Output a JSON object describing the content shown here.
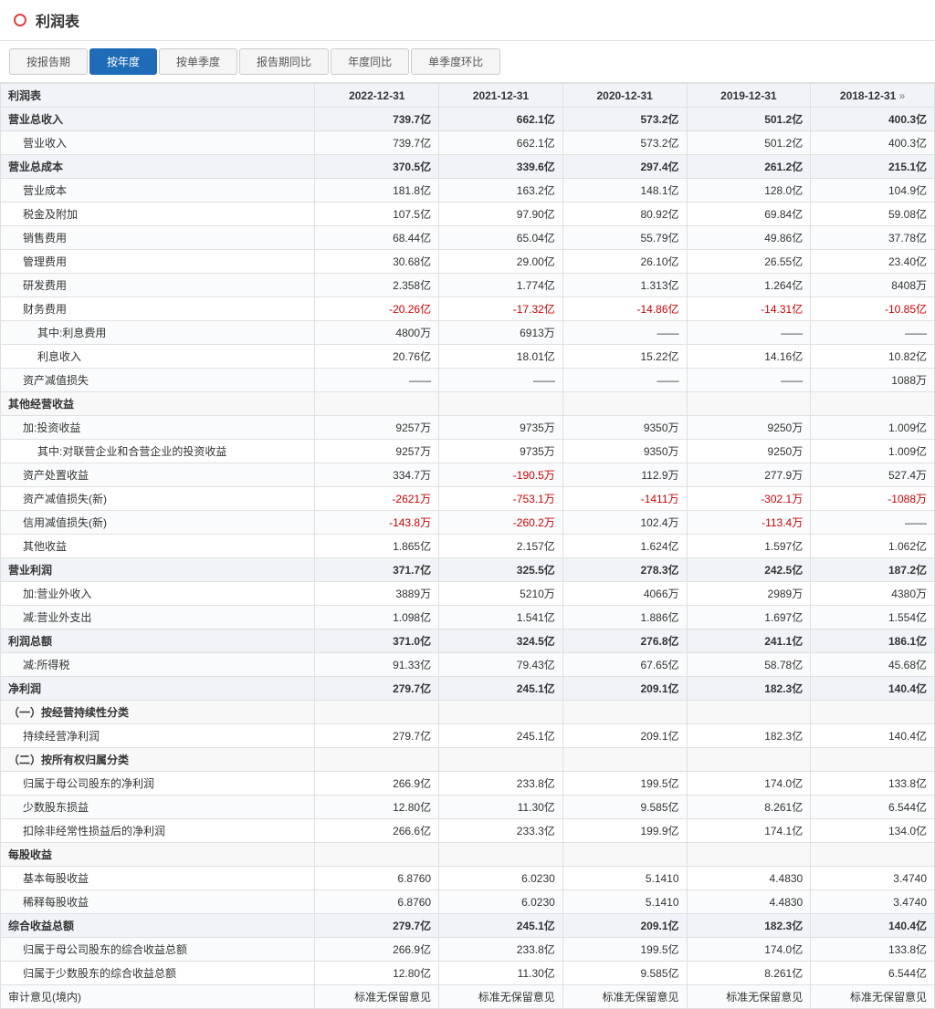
{
  "header": {
    "title": "利润表",
    "icon_label": "circle-icon"
  },
  "tabs": [
    {
      "id": "by-report",
      "label": "按报告期",
      "active": false
    },
    {
      "id": "by-year",
      "label": "按年度",
      "active": true
    },
    {
      "id": "by-quarter",
      "label": "按单季度",
      "active": false
    },
    {
      "id": "yoy-report",
      "label": "报告期同比",
      "active": false
    },
    {
      "id": "yoy-year",
      "label": "年度同比",
      "active": false
    },
    {
      "id": "qoq-quarter",
      "label": "单季度环比",
      "active": false
    }
  ],
  "columns": [
    "利润表",
    "2022-12-31",
    "2021-12-31",
    "2020-12-31",
    "2019-12-31",
    "2018-12-31"
  ],
  "rows": [
    {
      "label": "营业总收入",
      "values": [
        "739.7亿",
        "662.1亿",
        "573.2亿",
        "501.2亿",
        "400.3亿"
      ],
      "type": "bold"
    },
    {
      "label": "营业收入",
      "values": [
        "739.7亿",
        "662.1亿",
        "573.2亿",
        "501.2亿",
        "400.3亿"
      ],
      "type": "indent-1"
    },
    {
      "label": "营业总成本",
      "values": [
        "370.5亿",
        "339.6亿",
        "297.4亿",
        "261.2亿",
        "215.1亿"
      ],
      "type": "bold"
    },
    {
      "label": "营业成本",
      "values": [
        "181.8亿",
        "163.2亿",
        "148.1亿",
        "128.0亿",
        "104.9亿"
      ],
      "type": "indent-1"
    },
    {
      "label": "税金及附加",
      "values": [
        "107.5亿",
        "97.90亿",
        "80.92亿",
        "69.84亿",
        "59.08亿"
      ],
      "type": "indent-1"
    },
    {
      "label": "销售费用",
      "values": [
        "68.44亿",
        "65.04亿",
        "55.79亿",
        "49.86亿",
        "37.78亿"
      ],
      "type": "indent-1"
    },
    {
      "label": "管理费用",
      "values": [
        "30.68亿",
        "29.00亿",
        "26.10亿",
        "26.55亿",
        "23.40亿"
      ],
      "type": "indent-1"
    },
    {
      "label": "研发费用",
      "values": [
        "2.358亿",
        "1.774亿",
        "1.313亿",
        "1.264亿",
        "8408万"
      ],
      "type": "indent-1"
    },
    {
      "label": "财务费用",
      "values": [
        "-20.26亿",
        "-17.32亿",
        "-14.86亿",
        "-14.31亿",
        "-10.85亿"
      ],
      "type": "indent-1"
    },
    {
      "label": "其中:利息费用",
      "values": [
        "4800万",
        "6913万",
        "——",
        "——",
        "——"
      ],
      "type": "indent-2"
    },
    {
      "label": "利息收入",
      "values": [
        "20.76亿",
        "18.01亿",
        "15.22亿",
        "14.16亿",
        "10.82亿"
      ],
      "type": "indent-2"
    },
    {
      "label": "资产减值损失",
      "values": [
        "——",
        "——",
        "——",
        "——",
        "1088万"
      ],
      "type": "indent-1"
    },
    {
      "label": "其他经营收益",
      "values": [
        "",
        "",
        "",
        "",
        ""
      ],
      "type": "section"
    },
    {
      "label": "加:投资收益",
      "values": [
        "9257万",
        "9735万",
        "9350万",
        "9250万",
        "1.009亿"
      ],
      "type": "indent-1"
    },
    {
      "label": "其中:对联营企业和合营企业的投资收益",
      "values": [
        "9257万",
        "9735万",
        "9350万",
        "9250万",
        "1.009亿"
      ],
      "type": "indent-2"
    },
    {
      "label": "资产处置收益",
      "values": [
        "334.7万",
        "-190.5万",
        "112.9万",
        "277.9万",
        "527.4万"
      ],
      "type": "indent-1"
    },
    {
      "label": "资产减值损失(新)",
      "values": [
        "-2621万",
        "-753.1万",
        "-1411万",
        "-302.1万",
        "-1088万"
      ],
      "type": "indent-1"
    },
    {
      "label": "信用减值损失(新)",
      "values": [
        "-143.8万",
        "-260.2万",
        "102.4万",
        "-113.4万",
        "——"
      ],
      "type": "indent-1"
    },
    {
      "label": "其他收益",
      "values": [
        "1.865亿",
        "2.157亿",
        "1.624亿",
        "1.597亿",
        "1.062亿"
      ],
      "type": "indent-1"
    },
    {
      "label": "营业利润",
      "values": [
        "371.7亿",
        "325.5亿",
        "278.3亿",
        "242.5亿",
        "187.2亿"
      ],
      "type": "bold"
    },
    {
      "label": "加:营业外收入",
      "values": [
        "3889万",
        "5210万",
        "4066万",
        "2989万",
        "4380万"
      ],
      "type": "indent-1"
    },
    {
      "label": "减:营业外支出",
      "values": [
        "1.098亿",
        "1.541亿",
        "1.886亿",
        "1.697亿",
        "1.554亿"
      ],
      "type": "indent-1"
    },
    {
      "label": "利润总额",
      "values": [
        "371.0亿",
        "324.5亿",
        "276.8亿",
        "241.1亿",
        "186.1亿"
      ],
      "type": "bold"
    },
    {
      "label": "减:所得税",
      "values": [
        "91.33亿",
        "79.43亿",
        "67.65亿",
        "58.78亿",
        "45.68亿"
      ],
      "type": "indent-1"
    },
    {
      "label": "净利润",
      "values": [
        "279.7亿",
        "245.1亿",
        "209.1亿",
        "182.3亿",
        "140.4亿"
      ],
      "type": "bold"
    },
    {
      "label": "（一）按经营持续性分类",
      "values": [
        "",
        "",
        "",
        "",
        ""
      ],
      "type": "section"
    },
    {
      "label": "持续经营净利润",
      "values": [
        "279.7亿",
        "245.1亿",
        "209.1亿",
        "182.3亿",
        "140.4亿"
      ],
      "type": "indent-1"
    },
    {
      "label": "（二）按所有权归属分类",
      "values": [
        "",
        "",
        "",
        "",
        ""
      ],
      "type": "section"
    },
    {
      "label": "归属于母公司股东的净利润",
      "values": [
        "266.9亿",
        "233.8亿",
        "199.5亿",
        "174.0亿",
        "133.8亿"
      ],
      "type": "indent-1"
    },
    {
      "label": "少数股东损益",
      "values": [
        "12.80亿",
        "11.30亿",
        "9.585亿",
        "8.261亿",
        "6.544亿"
      ],
      "type": "indent-1"
    },
    {
      "label": "扣除非经常性损益后的净利润",
      "values": [
        "266.6亿",
        "233.3亿",
        "199.9亿",
        "174.1亿",
        "134.0亿"
      ],
      "type": "indent-1"
    },
    {
      "label": "每股收益",
      "values": [
        "",
        "",
        "",
        "",
        ""
      ],
      "type": "section"
    },
    {
      "label": "基本每股收益",
      "values": [
        "6.8760",
        "6.0230",
        "5.1410",
        "4.4830",
        "3.4740"
      ],
      "type": "indent-1"
    },
    {
      "label": "稀释每股收益",
      "values": [
        "6.8760",
        "6.0230",
        "5.1410",
        "4.4830",
        "3.4740"
      ],
      "type": "indent-1"
    },
    {
      "label": "综合收益总额",
      "values": [
        "279.7亿",
        "245.1亿",
        "209.1亿",
        "182.3亿",
        "140.4亿"
      ],
      "type": "bold"
    },
    {
      "label": "归属于母公司股东的综合收益总额",
      "values": [
        "266.9亿",
        "233.8亿",
        "199.5亿",
        "174.0亿",
        "133.8亿"
      ],
      "type": "indent-1"
    },
    {
      "label": "归属于少数股东的综合收益总额",
      "values": [
        "12.80亿",
        "11.30亿",
        "9.585亿",
        "8.261亿",
        "6.544亿"
      ],
      "type": "indent-1"
    },
    {
      "label": "审计意见(境内)",
      "values": [
        "标准无保留意见",
        "标准无保留意见",
        "标准无保留意见",
        "标准无保留意见",
        "标准无保留意见"
      ],
      "type": "normal"
    }
  ]
}
